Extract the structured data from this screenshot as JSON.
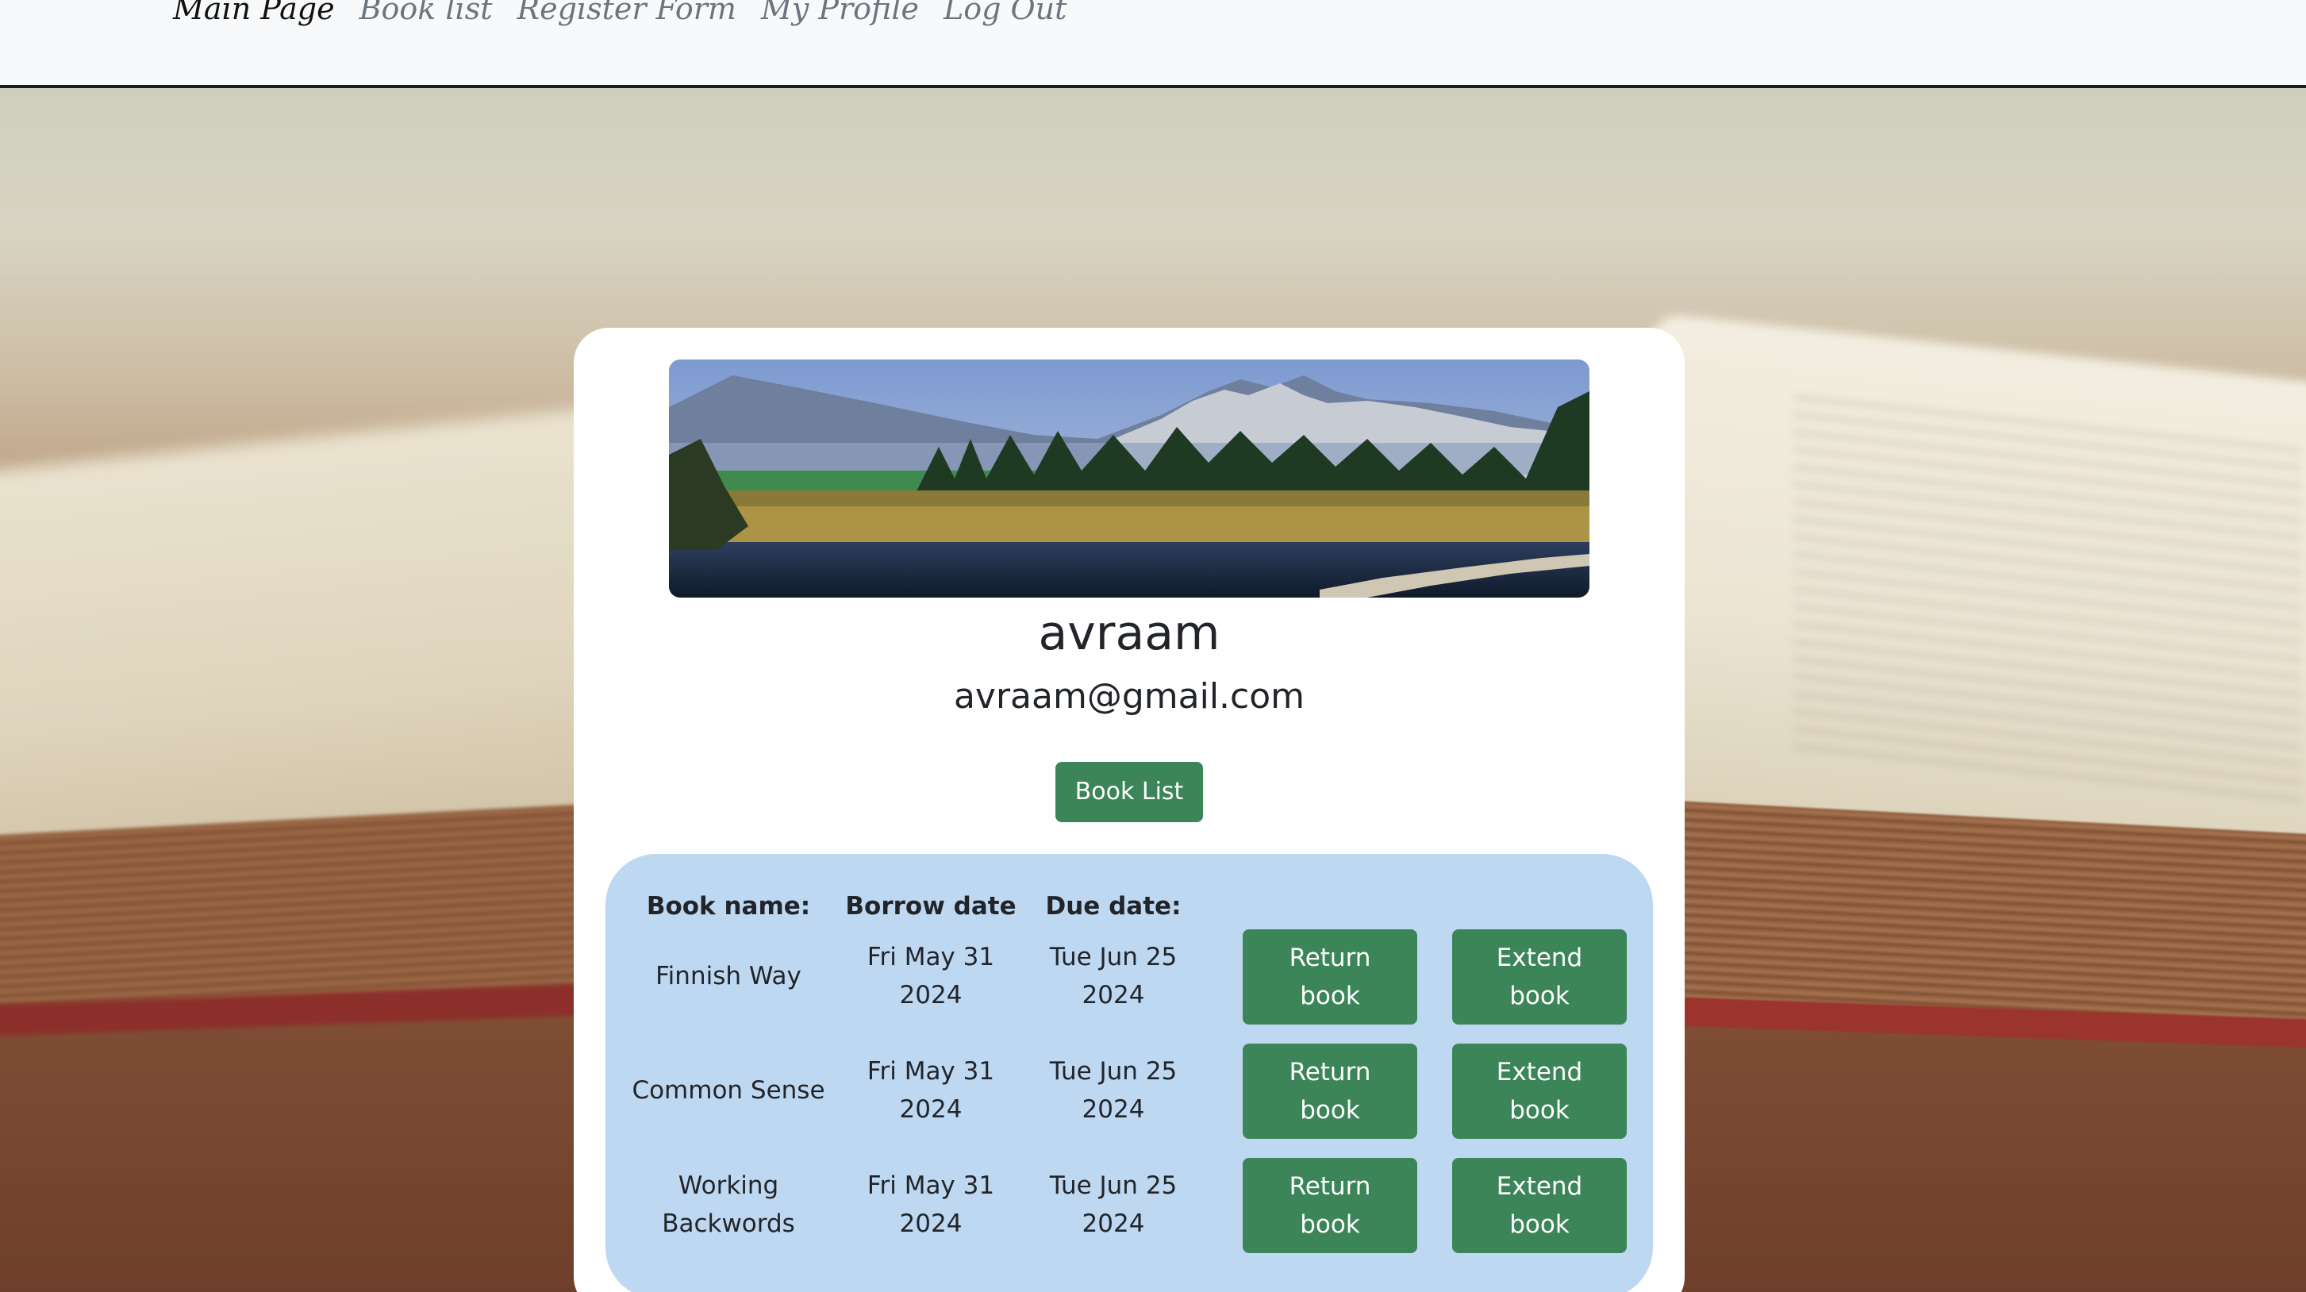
{
  "nav": {
    "links": [
      "Main Page",
      "Book list",
      "Register Form",
      "My Profile",
      "Log Out"
    ]
  },
  "profile": {
    "username": "avraam",
    "email": "avraam@gmail.com",
    "book_list_button": "Book List"
  },
  "table": {
    "headers": [
      "Book name:",
      "Borrow date",
      "Due date:"
    ],
    "rows": [
      {
        "name": "Finnish Way",
        "borrow": "Fri May 31 2024",
        "due": "Tue Jun 25 2024",
        "return_label": "Return book",
        "extend_label": "Extend book"
      },
      {
        "name": "Common Sense",
        "borrow": "Fri May 31 2024",
        "due": "Tue Jun 25 2024",
        "return_label": "Return book",
        "extend_label": "Extend book"
      },
      {
        "name": "Working Backwords",
        "borrow": "Fri May 31 2024",
        "due": "Tue Jun 25 2024",
        "return_label": "Return book",
        "extend_label": "Extend book"
      }
    ]
  },
  "colors": {
    "button_green": "#3c8558",
    "table_panel": "#bfd8f2",
    "navbar_bg": "#f8f9fa"
  }
}
